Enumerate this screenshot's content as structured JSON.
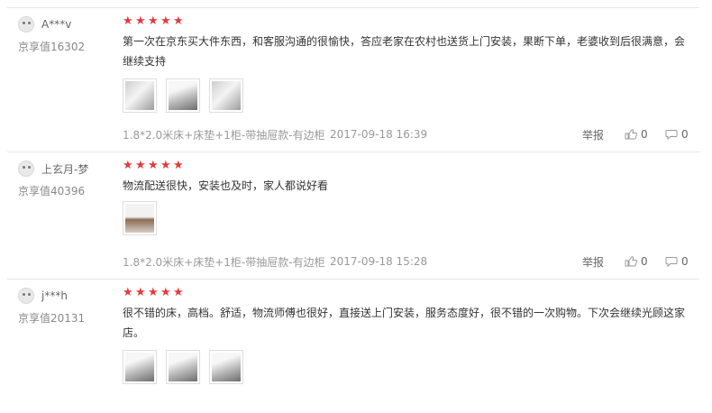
{
  "reviews": [
    {
      "user": {
        "name": "A***v",
        "level": "京享值16302"
      },
      "rating": 5,
      "text": "第一次在京东买大件东西，和客服沟通的很愉快，答应老家在农村也送货上门安装，果断下单，老婆收到后很满意，会继续支持",
      "photos": 3,
      "spec": "1.8*2.0米床+床垫+1柜-带抽屉款-有边柜",
      "time": "2017-09-18 16:39",
      "report": "举报",
      "likes": "0",
      "replies": "0"
    },
    {
      "user": {
        "name": "上玄月-梦",
        "level": "京享值40396"
      },
      "rating": 5,
      "text": "物流配送很快，安装也及时，家人都说好看",
      "photos": 1,
      "spec": "1.8*2.0米床+床垫+1柜-带抽屉款-有边柜",
      "time": "2017-09-18 15:28",
      "report": "举报",
      "likes": "0",
      "replies": "0"
    },
    {
      "user": {
        "name": "j***h",
        "level": "京享值20131"
      },
      "rating": 5,
      "text": "很不错的床，高档。舒适，物流师傅也很好，直接送上门安装，服务态度好，很不错的一次购物。下次会继续光顾这家店。",
      "photos": 3
    }
  ],
  "icons": {
    "star": "star-icon",
    "like": "thumb-up-icon",
    "reply": "comment-icon"
  },
  "colors": {
    "star": "#e4393c"
  }
}
